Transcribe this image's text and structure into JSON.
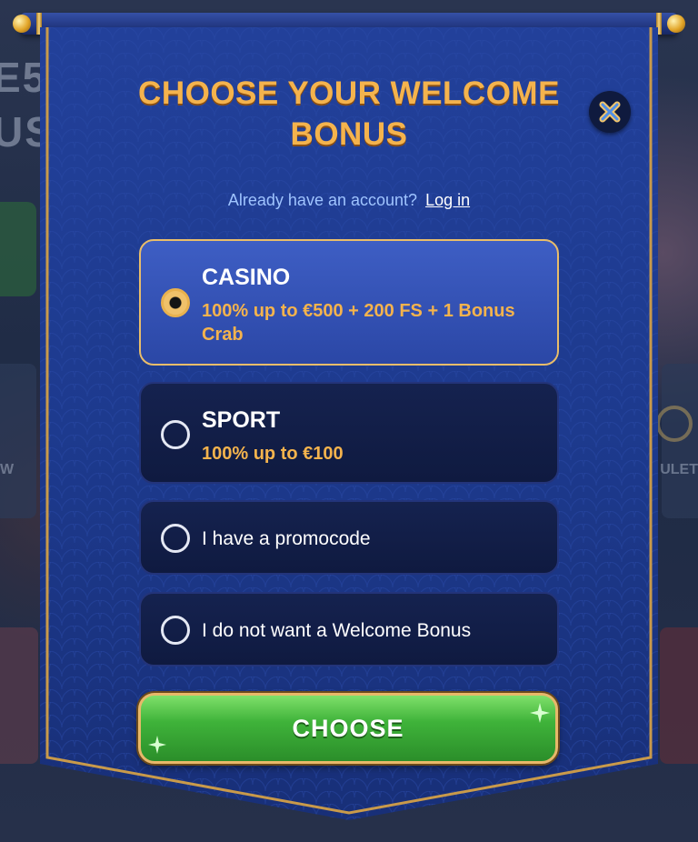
{
  "modal": {
    "title": "CHOOSE YOUR WELCOME BONUS",
    "login_prompt": "Already have an account?",
    "login_link": "Log in",
    "options": [
      {
        "title": "CASINO",
        "description": "100% up to €500 + 200 FS + 1 Bonus Crab",
        "selected": true
      },
      {
        "title": "SPORT",
        "description": "100% up to €100",
        "selected": false
      },
      {
        "label": "I have a promocode",
        "selected": false
      },
      {
        "label": "I do not want a Welcome Bonus",
        "selected": false
      }
    ],
    "choose_button": "CHOOSE",
    "close_icon": "close-x-icon"
  },
  "background": {
    "partial_text_1": "E5",
    "partial_text_2": "US",
    "partial_label_left": "W",
    "partial_label_right": "ULET"
  },
  "colors": {
    "title_gold": "#f4b34d",
    "panel_blue": "#1e3a8f",
    "selected_border": "#e9bd6a",
    "choose_green": "#3fb33a",
    "login_text": "#9fc4ff"
  }
}
